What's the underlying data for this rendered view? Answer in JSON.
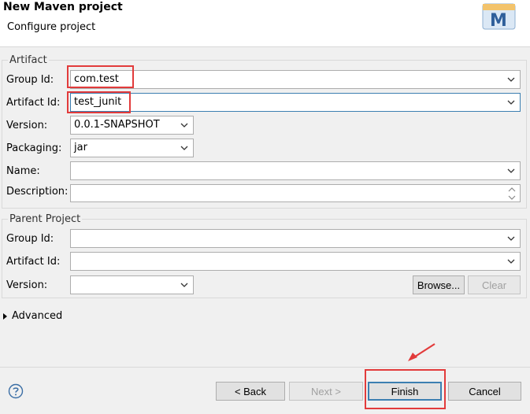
{
  "header": {
    "title": "New Maven project",
    "subtitle": "Configure project",
    "logo_letter": "M"
  },
  "artifact": {
    "group_title": "Artifact",
    "group_id_label": "Group Id:",
    "group_id_value": "com.test",
    "artifact_id_label": "Artifact Id:",
    "artifact_id_value": "test_junit",
    "version_label": "Version:",
    "version_value": "0.0.1-SNAPSHOT",
    "packaging_label": "Packaging:",
    "packaging_value": "jar",
    "name_label": "Name:",
    "name_value": "",
    "description_label": "Description:",
    "description_value": ""
  },
  "parent": {
    "group_title": "Parent Project",
    "group_id_label": "Group Id:",
    "artifact_id_label": "Artifact Id:",
    "version_label": "Version:",
    "browse_label": "Browse...",
    "clear_label": "Clear"
  },
  "advanced_label": "Advanced",
  "footer": {
    "back_label": "< Back",
    "next_label": "Next >",
    "finish_label": "Finish",
    "cancel_label": "Cancel",
    "help_icon": "help-icon"
  },
  "colors": {
    "highlight": "#e23b3b",
    "focus_border": "#3c7fb1",
    "dialog_bg": "#f0f0f0"
  }
}
